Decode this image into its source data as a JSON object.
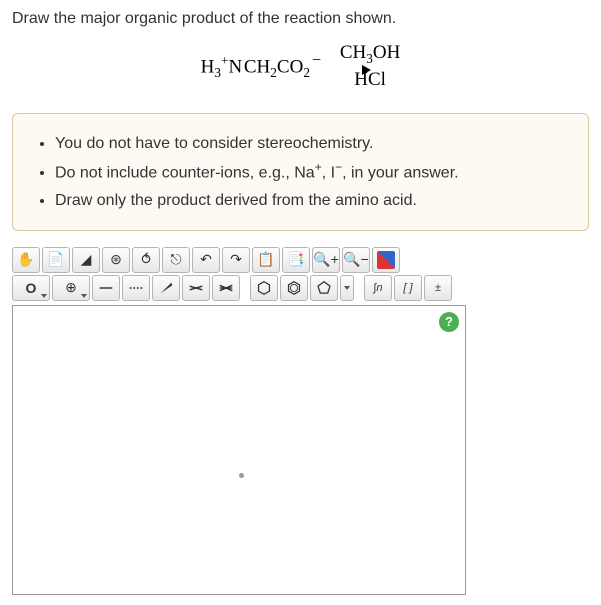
{
  "prompt": "Draw the major organic product of the reaction shown.",
  "reaction": {
    "reactant_html": "H<sub>3</sub><span class='plus'>+</span>N&#x200A;CH<sub>2</sub>CO<sub>2</sub><span class='minus'>−</span>",
    "reagent_top_html": "CH<sub>3</sub>OH",
    "reagent_bottom": "HCl"
  },
  "notes": [
    "You do not have to consider stereochemistry.",
    "Do not include counter-ions, e.g., Na<sup>+</sup>, I<sup>−</sup>, in your answer.",
    "Draw only the product derived from the amino acid."
  ],
  "toolbar_row1": [
    {
      "name": "hand-tool-icon",
      "glyph": "✋"
    },
    {
      "name": "new-doc-icon",
      "glyph": "📄"
    },
    {
      "name": "eraser-icon",
      "glyph": "◢"
    },
    {
      "name": "target-icon",
      "glyph": "⊛"
    },
    {
      "name": "chain-icon",
      "glyph": "⥀"
    },
    {
      "name": "ring-break-icon",
      "glyph": "⎋"
    },
    {
      "name": "undo-icon",
      "glyph": "↶"
    },
    {
      "name": "redo-icon",
      "glyph": "↷"
    },
    {
      "name": "paste-icon",
      "glyph": "📋"
    },
    {
      "name": "copy-struct-icon",
      "glyph": "📑"
    },
    {
      "name": "zoom-in-icon",
      "glyph": "🔍+"
    },
    {
      "name": "zoom-out-icon",
      "glyph": "🔍−"
    },
    {
      "name": "color-atoms-icon",
      "glyph": ""
    }
  ],
  "toolbar_row2": {
    "atom_label": "O",
    "charge_label": "⊕",
    "bonds": [
      {
        "name": "single-bond-icon"
      },
      {
        "name": "dotted-bond-icon"
      },
      {
        "name": "wedge-bond-icon"
      },
      {
        "name": "double-bond-icon"
      },
      {
        "name": "triple-bond-icon"
      }
    ],
    "rings": [
      {
        "name": "hexagon-icon"
      },
      {
        "name": "benzene-icon"
      },
      {
        "name": "pentagon-icon"
      }
    ],
    "right": [
      {
        "name": "curve-tool-icon",
        "label": "∫n"
      },
      {
        "name": "bracket-tool-icon",
        "label": "[ ]"
      },
      {
        "name": "charge-tool-icon",
        "label": "±"
      }
    ]
  },
  "help_label": "?"
}
